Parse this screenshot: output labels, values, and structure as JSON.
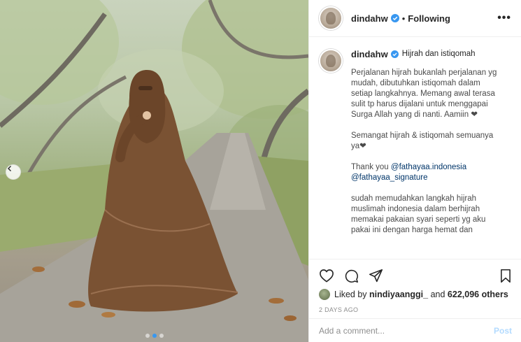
{
  "post": {
    "username": "dindahw",
    "follow_status": "Following",
    "separator": "•",
    "more_label": "•••",
    "caption": {
      "title": "Hijrah dan istiqomah",
      "p1": "Perjalanan hijrah bukanlah perjalanan yg mudah, dibutuhkan istiqomah dalam setiap langkahnya. Memang awal terasa sulit tp harus dijalani untuk menggapai Surga Allah yang di nanti. Aamiin ❤",
      "p2": "Semangat hijrah & istiqomah semuanya ya❤",
      "p3_prefix": "Thank you",
      "mention1": "@fathayaa.indonesia",
      "mention2": "@fathayaa_signature",
      "p4": "sudah memudahkan langkah hijrah muslimah indonesia dalam berhijrah memakai pakaian syari seperti yg aku pakai ini dengan harga hemat dan"
    },
    "likes": {
      "prefix": "Liked by",
      "user": "nindiyaanggi_",
      "and": "and",
      "count": "622,096 others"
    },
    "time": "2 DAYS AGO",
    "comment": {
      "placeholder": "Add a comment...",
      "post_label": "Post"
    },
    "carousel": {
      "slides": 3,
      "active": 1
    }
  },
  "icons": [
    "verified-badge-icon",
    "more-icon",
    "heart-icon",
    "comment-icon",
    "share-icon",
    "bookmark-icon",
    "chevron-left-icon"
  ],
  "colors": {
    "verified": "#3897f0",
    "post_disabled": "#b3dbff",
    "mention": "#003569",
    "dress": "#7a5233"
  }
}
